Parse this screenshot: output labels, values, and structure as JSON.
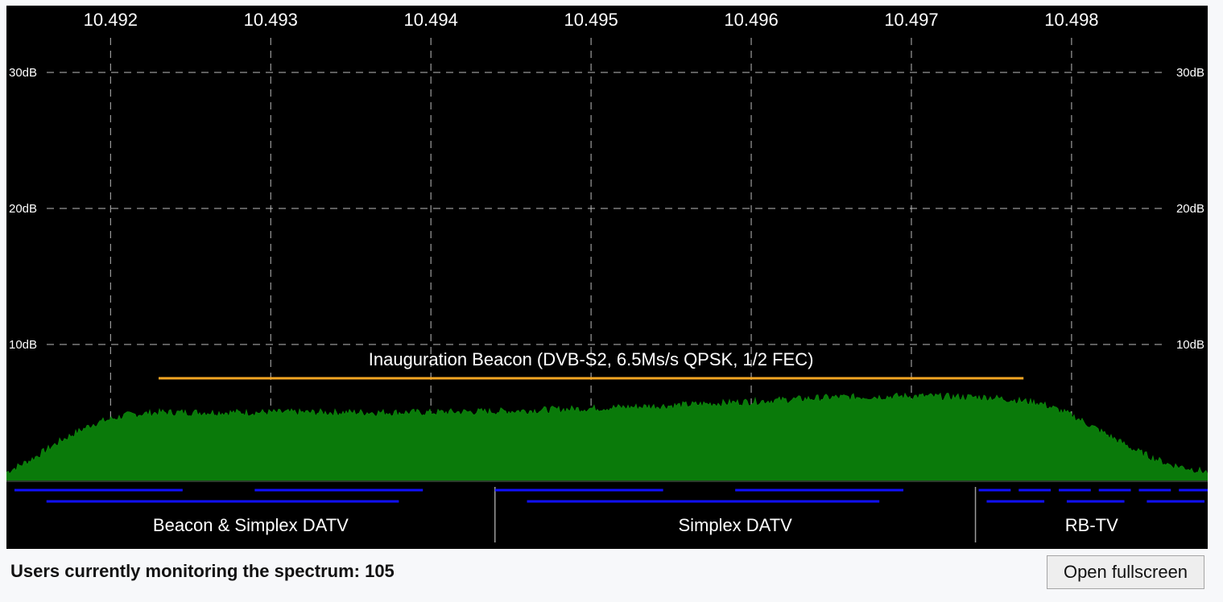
{
  "chart_data": {
    "type": "area",
    "x_unit": "GHz",
    "y_unit": "dB",
    "freq_ticks": [
      "10.492",
      "10.493",
      "10.494",
      "10.495",
      "10.496",
      "10.497",
      "10.498"
    ],
    "db_ticks": [
      "30dB",
      "20dB",
      "10dB"
    ],
    "ylim": [
      0,
      30
    ],
    "xlim": [
      10.49135,
      10.49885
    ],
    "grid": true,
    "signal_color": "#0a7a0a",
    "annotation": {
      "label": "Inauguration Beacon (DVB-S2, 6.5Ms/s QPSK, 1/2 FEC)",
      "from": 10.4923,
      "to": 10.4977,
      "color": "#f5a623"
    },
    "spectrum_envelope": {
      "x": [
        10.49135,
        10.4915,
        10.4917,
        10.4919,
        10.4921,
        10.4923,
        10.4925,
        10.493,
        10.4935,
        10.494,
        10.4945,
        10.495,
        10.4955,
        10.496,
        10.4965,
        10.497,
        10.4975,
        10.4978,
        10.498,
        10.4982,
        10.4984,
        10.4986,
        10.49885
      ],
      "y": [
        0.6,
        1.5,
        3.0,
        4.2,
        4.8,
        5.0,
        5.0,
        5.0,
        5.0,
        5.0,
        5.1,
        5.3,
        5.5,
        5.8,
        6.1,
        6.2,
        6.1,
        5.7,
        4.8,
        3.5,
        2.2,
        1.2,
        0.6
      ]
    },
    "bands": [
      {
        "label": "Beacon & Simplex DATV",
        "from": 10.49135,
        "to": 10.4944
      },
      {
        "label": "Simplex DATV",
        "from": 10.4944,
        "to": 10.4974
      },
      {
        "label": "RB-TV",
        "from": 10.4974,
        "to": 10.49885
      }
    ],
    "channel_color": "#1010ff",
    "channels": [
      {
        "row": 1,
        "from": 10.4914,
        "to": 10.49245
      },
      {
        "row": 1,
        "from": 10.4929,
        "to": 10.49395
      },
      {
        "row": 1,
        "from": 10.4944,
        "to": 10.49545
      },
      {
        "row": 1,
        "from": 10.4959,
        "to": 10.49695
      },
      {
        "row": 1,
        "from": 10.49742,
        "to": 10.49762
      },
      {
        "row": 1,
        "from": 10.49767,
        "to": 10.49787
      },
      {
        "row": 1,
        "from": 10.49792,
        "to": 10.49812
      },
      {
        "row": 1,
        "from": 10.49817,
        "to": 10.49837
      },
      {
        "row": 1,
        "from": 10.49842,
        "to": 10.49862
      },
      {
        "row": 1,
        "from": 10.49867,
        "to": 10.49887
      },
      {
        "row": 1,
        "from": 10.49892,
        "to": 10.49912
      },
      {
        "row": 1,
        "from": 10.49917,
        "to": 10.49937
      },
      {
        "row": 2,
        "from": 10.4916,
        "to": 10.4938
      },
      {
        "row": 2,
        "from": 10.4946,
        "to": 10.4968
      },
      {
        "row": 2,
        "from": 10.49747,
        "to": 10.49783
      },
      {
        "row": 2,
        "from": 10.49797,
        "to": 10.49833
      },
      {
        "row": 2,
        "from": 10.49847,
        "to": 10.49883
      },
      {
        "row": 2,
        "from": 10.49897,
        "to": 10.49933
      }
    ]
  },
  "footer": {
    "users_label": "Users currently monitoring the spectrum: 105",
    "fullscreen_button": "Open fullscreen"
  }
}
